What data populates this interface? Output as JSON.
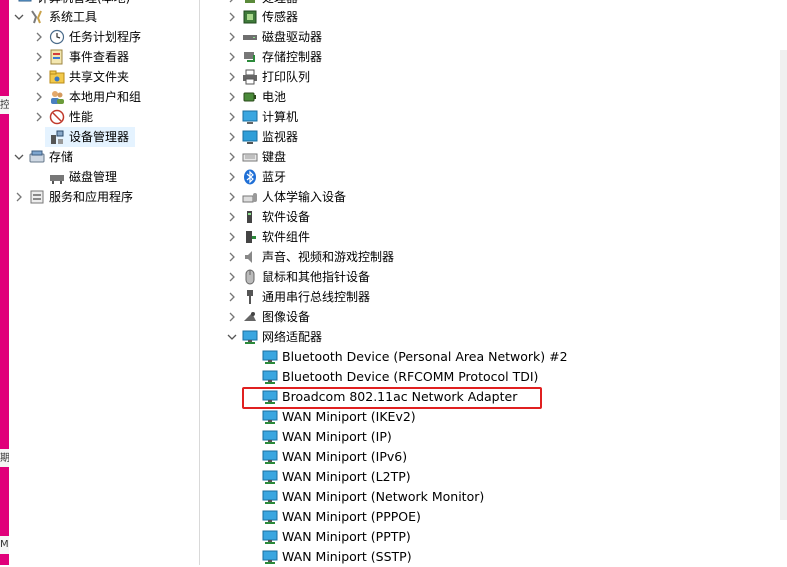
{
  "left_tree": {
    "cut_top_label": "计算机管理(本地)",
    "items": [
      {
        "label": "系统工具",
        "level": 1,
        "expanded": true,
        "icon": "tools-icon"
      },
      {
        "label": "任务计划程序",
        "level": 2,
        "expanded": false,
        "icon": "clock-icon"
      },
      {
        "label": "事件查看器",
        "level": 2,
        "expanded": false,
        "icon": "event-log-icon"
      },
      {
        "label": "共享文件夹",
        "level": 2,
        "expanded": false,
        "icon": "shared-folder-icon"
      },
      {
        "label": "本地用户和组",
        "level": 2,
        "expanded": false,
        "icon": "users-icon"
      },
      {
        "label": "性能",
        "level": 2,
        "expanded": false,
        "icon": "performance-icon"
      },
      {
        "label": "设备管理器",
        "level": 2,
        "selected": true,
        "icon": "device-manager-icon"
      },
      {
        "label": "存储",
        "level": 1,
        "expanded": true,
        "icon": "storage-icon"
      },
      {
        "label": "磁盘管理",
        "level": 2,
        "icon": "disk-management-icon"
      },
      {
        "label": "服务和应用程序",
        "level": 1,
        "expanded": false,
        "icon": "services-icon"
      }
    ]
  },
  "device_tree": {
    "categories": [
      {
        "label": "处理器",
        "icon": "processor-icon"
      },
      {
        "label": "传感器",
        "icon": "sensor-icon"
      },
      {
        "label": "磁盘驱动器",
        "icon": "disk-drive-icon"
      },
      {
        "label": "存储控制器",
        "icon": "storage-controller-icon"
      },
      {
        "label": "打印队列",
        "icon": "printer-icon"
      },
      {
        "label": "电池",
        "icon": "battery-icon"
      },
      {
        "label": "计算机",
        "icon": "computer-icon"
      },
      {
        "label": "监视器",
        "icon": "monitor-icon"
      },
      {
        "label": "键盘",
        "icon": "keyboard-icon"
      },
      {
        "label": "蓝牙",
        "icon": "bluetooth-icon"
      },
      {
        "label": "人体学输入设备",
        "icon": "hid-icon"
      },
      {
        "label": "软件设备",
        "icon": "software-device-icon"
      },
      {
        "label": "软件组件",
        "icon": "software-component-icon"
      },
      {
        "label": "声音、视频和游戏控制器",
        "icon": "speaker-icon"
      },
      {
        "label": "鼠标和其他指针设备",
        "icon": "mouse-icon"
      },
      {
        "label": "通用串行总线控制器",
        "icon": "usb-icon"
      },
      {
        "label": "图像设备",
        "icon": "camera-icon"
      },
      {
        "label": "网络适配器",
        "icon": "network-adapter-icon",
        "expanded": true
      }
    ],
    "network_adapters": [
      "Bluetooth Device (Personal Area Network) #2",
      "Bluetooth Device (RFCOMM Protocol TDI)",
      "Broadcom 802.11ac Network Adapter",
      "WAN Miniport (IKEv2)",
      "WAN Miniport (IP)",
      "WAN Miniport (IPv6)",
      "WAN Miniport (L2TP)",
      "WAN Miniport (Network Monitor)",
      "WAN Miniport (PPPOE)",
      "WAN Miniport (PPTP)",
      "WAN Miniport (SSTP)"
    ],
    "highlighted_adapter": "Broadcom 802.11ac Network Adapter"
  },
  "edge_fragments": [
    "控",
    "期",
    "M"
  ],
  "colors": {
    "accent_edge": "#e0007a",
    "highlight_border": "#e02020",
    "selection_bg": "#e5f3ff"
  }
}
